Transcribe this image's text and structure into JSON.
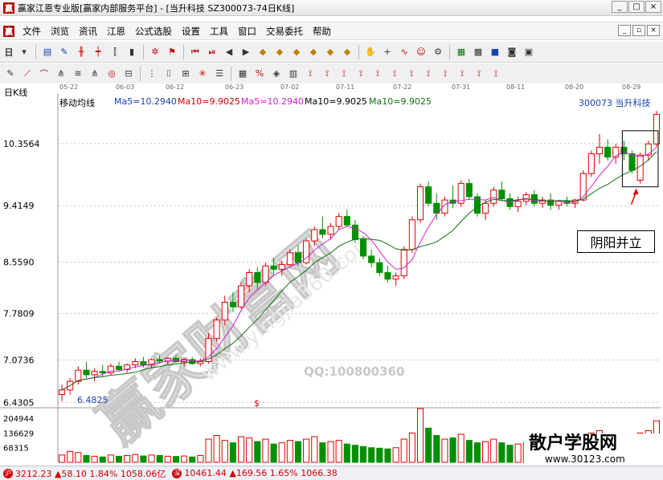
{
  "window": {
    "title": "赢家江恩专业版[赢家内部服务平台] - [当升科技  SZ300073-74日K线]",
    "buttons": [
      "_",
      "□",
      "×"
    ]
  },
  "menu": {
    "logo": "赢",
    "items": [
      "文件",
      "浏览",
      "资讯",
      "江恩",
      "公式选股",
      "设置",
      "工具",
      "窗口",
      "交易委托",
      "帮助"
    ],
    "mdi_buttons": [
      "_",
      "▫",
      "×"
    ]
  },
  "toolbar1": {
    "period_label": "日",
    "icons": [
      "dropdown-icon",
      "chart-style-icon",
      "drawing-icon",
      "kline-icon",
      "bar-icon",
      "volume-icon",
      "cursor-icon",
      "gann-icon",
      "flag-icon",
      "first-icon",
      "prev-icon",
      "next-icon",
      "last-icon",
      "diamond1-icon",
      "diamond2-icon",
      "diamond3-icon",
      "diamond4-icon",
      "diamond5-icon",
      "diamond6-icon",
      "hand-icon",
      "crosshair-icon",
      "zigzag-icon",
      "face-icon",
      "gear-icon",
      "calendar-icon",
      "calculator-icon",
      "save-icon",
      "camera-icon",
      "truck-icon"
    ]
  },
  "toolbar2": {
    "icons": [
      "pencil-icon",
      "fan-icon",
      "arc-icon",
      "fork-icon",
      "wave-icon",
      "fork2-icon",
      "circle-grid-icon",
      "line-icon",
      "vline-icon",
      "bracket-icon",
      "box-icon",
      "star-icon",
      "list-icon",
      "grid-icon",
      "percent-icon",
      "label-icon",
      "ruler-icon",
      "tool1-icon",
      "tool2-icon",
      "tool3-icon",
      "tool4-icon",
      "tool5-icon",
      "tool6-icon",
      "tool7-icon",
      "tool8-icon",
      "tool9-icon",
      "tool10-icon",
      "tool11-icon",
      "tool12-icon"
    ]
  },
  "dates": [
    "05-22",
    "06-03",
    "06-12",
    "06-23",
    "07-02",
    "07-11",
    "07-22",
    "07-31",
    "08-11",
    "08-20",
    "08-29"
  ],
  "legend": {
    "kline_label": "日K线",
    "indicator": "移动均线",
    "ma5a": "Ma5=10.2940",
    "ma10a": "Ma10=9.9025",
    "ma5b": "Ma5=10.2940",
    "ma10b": "Ma10=9.9025",
    "ma10c": "Ma10=9.9025",
    "stock": "300073  当升科技"
  },
  "colors": {
    "up": "#e00000",
    "down": "#009000",
    "ma5": "#d020d0",
    "ma10": "#107010",
    "watermark": "#dddddd"
  },
  "annotation": "阴阳并立",
  "watermark": {
    "main": "赢家财富网",
    "url": "www.yingjia360.com",
    "qq": "QQ:100800360"
  },
  "low_label": "6.4825",
  "dollar_mark": "$",
  "site_badge": {
    "name": "散户学股网",
    "url": "www.30123.com"
  },
  "chart_data": {
    "type": "candlestick",
    "y_ticks": [
      "10.3564",
      "9.4149",
      "8.5590",
      "7.7809",
      "7.0736",
      "6.4305"
    ],
    "volume_ticks": [
      "204944",
      "136629",
      "68315"
    ],
    "ohlc": [
      [
        6.55,
        6.7,
        6.45,
        6.62
      ],
      [
        6.62,
        6.8,
        6.55,
        6.75
      ],
      [
        6.75,
        6.98,
        6.7,
        6.92
      ],
      [
        6.92,
        7.05,
        6.8,
        6.85
      ],
      [
        6.85,
        6.95,
        6.75,
        6.9
      ],
      [
        6.9,
        7.0,
        6.82,
        6.88
      ],
      [
        6.88,
        7.02,
        6.85,
        6.98
      ],
      [
        6.98,
        7.05,
        6.9,
        6.93
      ],
      [
        6.93,
        7.02,
        6.88,
        7.0
      ],
      [
        7.0,
        7.1,
        6.95,
        7.05
      ],
      [
        7.05,
        7.12,
        6.96,
        7.0
      ],
      [
        7.0,
        7.1,
        6.95,
        7.08
      ],
      [
        7.08,
        7.14,
        7.02,
        7.06
      ],
      [
        7.06,
        7.12,
        7.0,
        7.1
      ],
      [
        7.1,
        7.15,
        7.03,
        7.05
      ],
      [
        7.05,
        7.1,
        6.98,
        7.08
      ],
      [
        7.08,
        7.12,
        7.0,
        7.02
      ],
      [
        7.02,
        7.1,
        6.98,
        7.05
      ],
      [
        7.05,
        7.48,
        7.02,
        7.4
      ],
      [
        7.4,
        7.72,
        7.35,
        7.68
      ],
      [
        7.68,
        8.05,
        7.6,
        7.95
      ],
      [
        7.95,
        8.1,
        7.8,
        7.88
      ],
      [
        7.88,
        8.25,
        7.85,
        8.2
      ],
      [
        8.2,
        8.45,
        8.1,
        8.4
      ],
      [
        8.4,
        8.48,
        8.15,
        8.25
      ],
      [
        8.25,
        8.55,
        8.2,
        8.5
      ],
      [
        8.5,
        8.62,
        8.38,
        8.45
      ],
      [
        8.45,
        8.58,
        8.35,
        8.52
      ],
      [
        8.52,
        8.75,
        8.48,
        8.7
      ],
      [
        8.7,
        8.82,
        8.5,
        8.55
      ],
      [
        8.55,
        8.92,
        8.52,
        8.88
      ],
      [
        8.88,
        9.1,
        8.8,
        9.05
      ],
      [
        9.05,
        9.25,
        8.92,
        8.98
      ],
      [
        8.98,
        9.15,
        8.9,
        9.1
      ],
      [
        9.1,
        9.3,
        9.05,
        9.25
      ],
      [
        9.25,
        9.35,
        9.1,
        9.12
      ],
      [
        9.12,
        9.2,
        8.85,
        8.9
      ],
      [
        8.9,
        8.95,
        8.6,
        8.65
      ],
      [
        8.65,
        8.75,
        8.48,
        8.55
      ],
      [
        8.55,
        8.62,
        8.35,
        8.4
      ],
      [
        8.4,
        8.5,
        8.25,
        8.3
      ],
      [
        8.3,
        8.4,
        8.2,
        8.35
      ],
      [
        8.35,
        8.8,
        8.3,
        8.75
      ],
      [
        8.75,
        9.25,
        8.7,
        9.2
      ],
      [
        9.2,
        9.75,
        9.15,
        9.7
      ],
      [
        9.7,
        9.78,
        9.4,
        9.45
      ],
      [
        9.45,
        9.6,
        9.2,
        9.3
      ],
      [
        9.3,
        9.55,
        9.25,
        9.5
      ],
      [
        9.5,
        9.72,
        9.38,
        9.45
      ],
      [
        9.45,
        9.8,
        9.4,
        9.75
      ],
      [
        9.75,
        9.82,
        9.5,
        9.55
      ],
      [
        9.55,
        9.6,
        9.25,
        9.3
      ],
      [
        9.3,
        9.5,
        9.2,
        9.45
      ],
      [
        9.45,
        9.7,
        9.4,
        9.65
      ],
      [
        9.65,
        9.78,
        9.48,
        9.52
      ],
      [
        9.52,
        9.6,
        9.35,
        9.4
      ],
      [
        9.4,
        9.55,
        9.32,
        9.48
      ],
      [
        9.48,
        9.62,
        9.42,
        9.58
      ],
      [
        9.58,
        9.65,
        9.4,
        9.45
      ],
      [
        9.45,
        9.55,
        9.38,
        9.5
      ],
      [
        9.5,
        9.6,
        9.35,
        9.42
      ],
      [
        9.42,
        9.5,
        9.35,
        9.48
      ],
      [
        9.48,
        9.55,
        9.4,
        9.45
      ],
      [
        9.45,
        9.52,
        9.38,
        9.5
      ],
      [
        9.5,
        9.95,
        9.48,
        9.9
      ],
      [
        9.9,
        10.25,
        9.85,
        10.2
      ],
      [
        10.2,
        10.5,
        10.05,
        10.3
      ],
      [
        10.3,
        10.42,
        10.1,
        10.15
      ],
      [
        10.15,
        10.35,
        10.05,
        10.3
      ],
      [
        10.3,
        10.4,
        10.1,
        10.2
      ],
      [
        10.2,
        10.25,
        9.9,
        9.95
      ],
      [
        9.8,
        10.22,
        9.75,
        10.18
      ],
      [
        10.18,
        10.4,
        10.1,
        10.35
      ],
      [
        10.35,
        10.85,
        10.3,
        10.8
      ]
    ],
    "volume": [
      30,
      45,
      40,
      28,
      25,
      22,
      30,
      25,
      28,
      32,
      26,
      30,
      28,
      25,
      24,
      26,
      22,
      28,
      95,
      110,
      90,
      80,
      105,
      100,
      85,
      95,
      75,
      80,
      90,
      85,
      95,
      105,
      80,
      85,
      90,
      75,
      70,
      65,
      60,
      58,
      55,
      60,
      95,
      120,
      220,
      140,
      110,
      95,
      100,
      115,
      90,
      80,
      85,
      95,
      80,
      70,
      75,
      80,
      70,
      65,
      62,
      60,
      58,
      60,
      105,
      120,
      130,
      100,
      95,
      90,
      85,
      120,
      130,
      170
    ]
  }
}
